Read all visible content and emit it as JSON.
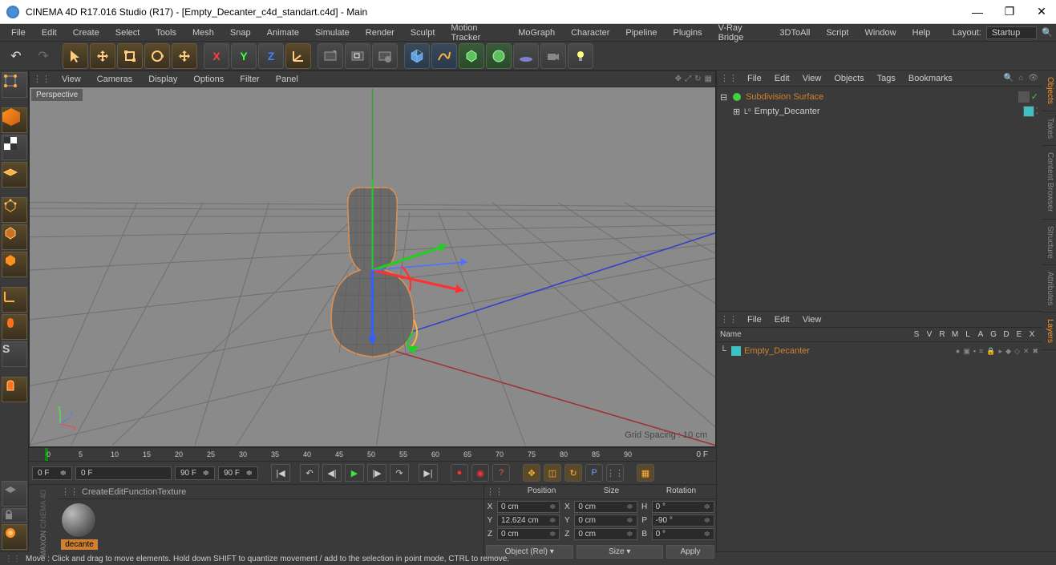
{
  "titlebar": {
    "title": "CINEMA 4D R17.016 Studio (R17) - [Empty_Decanter_c4d_standart.c4d] - Main"
  },
  "menubar": {
    "items": [
      "File",
      "Edit",
      "Create",
      "Select",
      "Tools",
      "Mesh",
      "Snap",
      "Animate",
      "Simulate",
      "Render",
      "Sculpt",
      "Motion Tracker",
      "MoGraph",
      "Character",
      "Pipeline",
      "Plugins",
      "V-Ray Bridge",
      "3DToAll",
      "Script",
      "Window",
      "Help"
    ],
    "layout_label": "Layout:",
    "layout_value": "Startup"
  },
  "viewport": {
    "menu": [
      "View",
      "Cameras",
      "Display",
      "Options",
      "Filter",
      "Panel"
    ],
    "label": "Perspective",
    "grid_spacing": "Grid Spacing : 10 cm"
  },
  "timeline": {
    "ticks": [
      "0",
      "5",
      "10",
      "15",
      "20",
      "25",
      "30",
      "35",
      "40",
      "45",
      "50",
      "55",
      "60",
      "65",
      "70",
      "75",
      "80",
      "85",
      "90"
    ],
    "end_label": "0 F",
    "frame_start": "0 F",
    "frame_in": "0 F",
    "frame_out": "90 F",
    "frame_current": "90 F"
  },
  "material": {
    "menu": [
      "Create",
      "Edit",
      "Function",
      "Texture"
    ],
    "name": "decante"
  },
  "coord": {
    "headers": [
      "Position",
      "Size",
      "Rotation"
    ],
    "rows": [
      {
        "axis": "X",
        "pos": "0 cm",
        "sizeAxis": "X",
        "size": "0 cm",
        "rotAxis": "H",
        "rot": "0 °"
      },
      {
        "axis": "Y",
        "pos": "12.624 cm",
        "sizeAxis": "Y",
        "size": "0 cm",
        "rotAxis": "P",
        "rot": "-90 °"
      },
      {
        "axis": "Z",
        "pos": "0 cm",
        "sizeAxis": "Z",
        "size": "0 cm",
        "rotAxis": "B",
        "rot": "0 °"
      }
    ],
    "mode1": "Object (Rel)",
    "mode2": "Size",
    "apply": "Apply"
  },
  "objects_panel": {
    "menu": [
      "File",
      "Edit",
      "View",
      "Objects",
      "Tags",
      "Bookmarks"
    ],
    "root": "Subdivision Surface",
    "child": "Empty_Decanter"
  },
  "layers_panel": {
    "menu": [
      "File",
      "Edit",
      "View"
    ],
    "name_col": "Name",
    "cols": [
      "S",
      "V",
      "R",
      "M",
      "L",
      "A",
      "G",
      "D",
      "E",
      "X"
    ],
    "layer": "Empty_Decanter"
  },
  "right_tabs": [
    "Objects",
    "Takes",
    "Content Browser",
    "Structure",
    "Attributes",
    "Layers"
  ],
  "statusbar": {
    "text": "Move : Click and drag to move elements. Hold down SHIFT to quantize movement / add to the selection in point mode, CTRL to remove."
  },
  "maxon_label": "CINEMA 4D"
}
